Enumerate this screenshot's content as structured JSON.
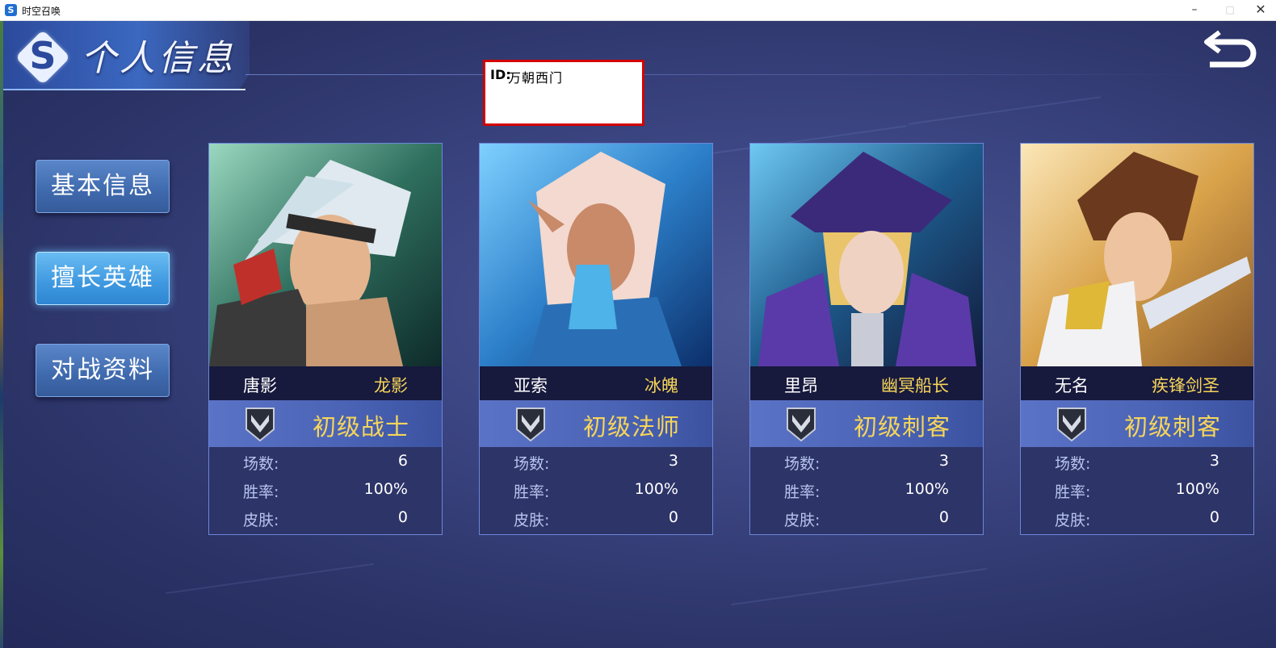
{
  "window": {
    "title": "时空召唤",
    "app_icon_letter": "S",
    "controls": {
      "minimize": "–",
      "maximize": "□",
      "close": "✕"
    }
  },
  "header": {
    "logo_letter": "S",
    "title": "个人信息",
    "back_icon": "back-arrow-icon"
  },
  "overlay": {
    "id_label": "ID:",
    "id_value": "万朝西门"
  },
  "nav": [
    {
      "label": "基本信息",
      "active": false
    },
    {
      "label": "擅长英雄",
      "active": true
    },
    {
      "label": "对战资料",
      "active": false
    }
  ],
  "stat_labels": {
    "games": "场数:",
    "winrate": "胜率:",
    "skins": "皮肤:"
  },
  "cards": [
    {
      "name": "唐影",
      "title": "龙影",
      "rank": "初级战士",
      "games": "6",
      "winrate": "100%",
      "skins": "0",
      "theme_color": "#2f6f5e",
      "hair_color": "#dfe9ef"
    },
    {
      "name": "亚索",
      "title": "冰魄",
      "rank": "初级法师",
      "games": "3",
      "winrate": "100%",
      "skins": "0",
      "theme_color": "#2c7fc9",
      "hair_color": "#f3d9cf"
    },
    {
      "name": "里昂",
      "title": "幽冥船长",
      "rank": "初级刺客",
      "games": "3",
      "winrate": "100%",
      "skins": "0",
      "theme_color": "#1d5a8c",
      "hair_color": "#e9c46a"
    },
    {
      "name": "无名",
      "title": "疾锋剑圣",
      "rank": "初级刺客",
      "games": "3",
      "winrate": "100%",
      "skins": "0",
      "theme_color": "#d9a24a",
      "hair_color": "#6b3a1e"
    }
  ]
}
